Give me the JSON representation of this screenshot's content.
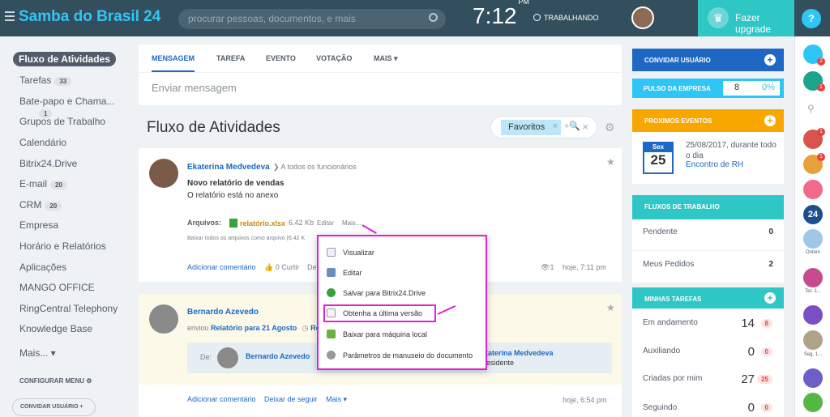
{
  "header": {
    "brand": "Samba do Brasil",
    "brand_num": "24",
    "search_placeholder": "procurar pessoas, documentos, e mais",
    "time": "7:12",
    "ampm": "PM",
    "work_status": "TRABALHANDO",
    "upgrade": "Fazer upgrade",
    "help": "?"
  },
  "sidebar": {
    "items": [
      {
        "label": "Fluxo de Atividades"
      },
      {
        "label": "Tarefas",
        "count": "33"
      },
      {
        "label": "Bate-papo e Chama...",
        "count": "1"
      },
      {
        "label": "Grupos de Trabalho"
      },
      {
        "label": "Calendário"
      },
      {
        "label": "Bitrix24.Drive"
      },
      {
        "label": "E-mail",
        "count": "20"
      },
      {
        "label": "CRM",
        "count": "20"
      },
      {
        "label": "Empresa"
      },
      {
        "label": "Horário e Relatórios"
      },
      {
        "label": "Aplicações"
      },
      {
        "label": "MANGO OFFICE"
      },
      {
        "label": "RingCentral Telephony"
      },
      {
        "label": "Knowledge Base"
      },
      {
        "label": "Mais..."
      }
    ],
    "configure": "CONFIGURAR MENU",
    "invite": "CONVIDAR USUÁRIO +"
  },
  "composer": {
    "tabs": [
      "MENSAGEM",
      "TAREFA",
      "EVENTO",
      "VOTAÇÃO",
      "MAIS"
    ],
    "placeholder": "Enviar mensagem"
  },
  "feed": {
    "title": "Fluxo de Atividades",
    "filter": "Favoritos",
    "post1": {
      "author": "Ekaterina Medvedeva",
      "to": "A todos os funcionários",
      "title": "Novo relatório de vendas",
      "body": "O relatório está no anexo",
      "files_label": "Arquivos:",
      "file": "relatório.xlsx",
      "size": "6.42 Kb",
      "edit": "Editar",
      "more": "Mais...",
      "download_all": "Baixar todos os arquivos como arquivo (6.42 K",
      "comment": "Adicionar comentário",
      "like": "0 Curtir",
      "de": "De",
      "views": "1",
      "time": "hoje, 7:11 pm"
    },
    "post2": {
      "author": "Bernardo Azevedo",
      "sent": "enviou",
      "report": "Relatório para 21 Agosto",
      "from": "De:",
      "from_name": "Bernardo Azevedo",
      "to_name": "katerina Medvedeva",
      "to_role": "residente",
      "comment": "Adicionar comentário",
      "unfollow": "Deixar de seguir",
      "more": "Mais",
      "time": "hoje, 6:54 pm",
      "re": "Re"
    }
  },
  "popup": {
    "items": [
      "Visualizar",
      "Editar",
      "Salvar para Bitrix24.Drive",
      "Obtenha a última versão",
      "Baixar para máquina local",
      "Parâmetros de manuseio do documento"
    ]
  },
  "right": {
    "invite": "CONVIDAR USUÁRIO",
    "pulse": "PULSO DA EMPRESA",
    "pulse_val": "8",
    "pulse_pct": "0%",
    "events": "PROXIMOS EVENTOS",
    "ev_day": "Sex",
    "ev_num": "25",
    "ev_date": "25/08/2017, durante todo o dia",
    "ev_name": "Encontro de RH",
    "workflows": "FLUXOS DE TRABALHO",
    "wf": [
      {
        "label": "Pendente",
        "v": "0"
      },
      {
        "label": "Meus Pedidos",
        "v": "2"
      }
    ],
    "tasks": "MINHAS TAREFAS",
    "tk": [
      {
        "label": "Em andamento",
        "n": "14",
        "b": "8"
      },
      {
        "label": "Auxiliando",
        "n": "0",
        "b": "0"
      },
      {
        "label": "Criadas por mim",
        "n": "27",
        "b": "25"
      },
      {
        "label": "Seguindo",
        "n": "0",
        "b": "0"
      }
    ]
  },
  "rail": {
    "badge1": "2",
    "badge2": "1",
    "badge3": "1",
    "badge4": "1",
    "label1": "Ontem",
    "label2": "Ter, 1...",
    "label3": "Seg, 1...",
    "num24": "24"
  }
}
